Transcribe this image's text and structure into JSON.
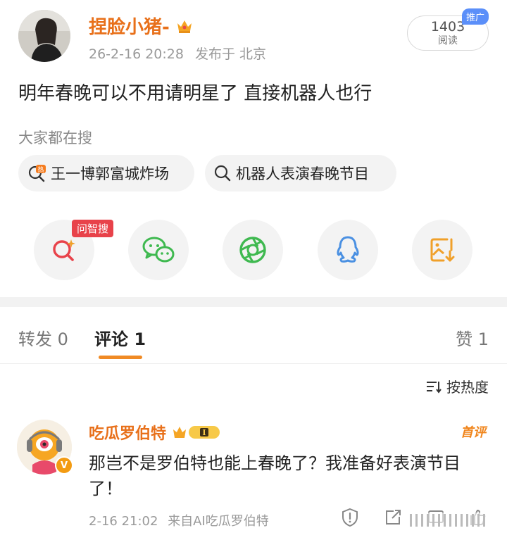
{
  "post": {
    "username": "捏脸小猪-",
    "date": "26-2-16 20:28",
    "location": "发布于 北京",
    "reads": "1403",
    "reads_label": "阅读",
    "promo": "推广",
    "text": "明年春晚可以不用请明星了 直接机器人也行"
  },
  "search": {
    "heading": "大家都在搜",
    "chips": [
      "王一博郭富城炸场",
      "机器人表演春晚节目"
    ]
  },
  "share": {
    "ai_badge": "问智搜",
    "buttons": [
      "ai-search",
      "wechat",
      "moments",
      "qq",
      "save-image"
    ]
  },
  "tabs": {
    "repost": "转发 0",
    "comment": "评论 1",
    "like": "赞 1"
  },
  "sort": {
    "label": "按热度"
  },
  "comment": {
    "name": "吃瓜罗伯特",
    "level": "I",
    "tag": "首评",
    "text": "那岂不是罗伯特也能上春晚了？我准备好表演节目了！",
    "time": "2-16 21:02",
    "source": "来自AI吃瓜罗伯特",
    "verified": "V"
  },
  "colors": {
    "brand_orange": "#e8701a",
    "ai_red": "#e8424a",
    "wechat_green": "#3fb950",
    "qq_blue": "#4a90e2",
    "save_orange": "#f0a02a"
  }
}
